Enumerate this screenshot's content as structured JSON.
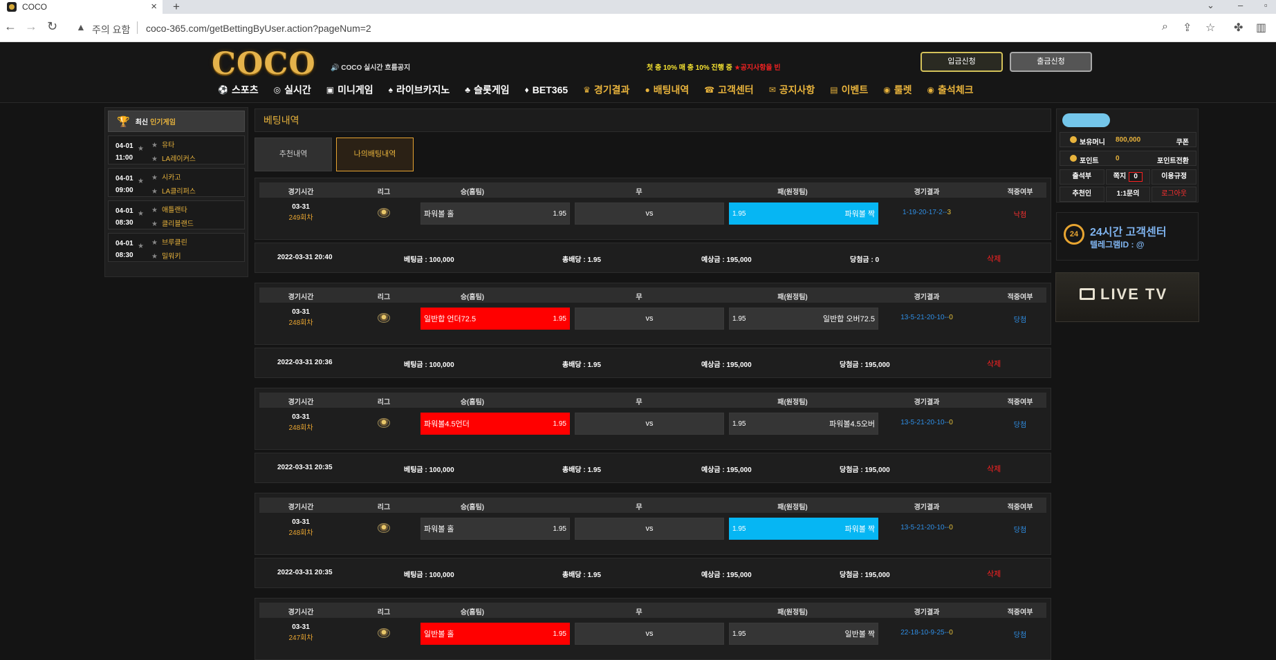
{
  "browser": {
    "tab_title": "COCO",
    "tab_close": "×",
    "new_tab": "+",
    "warning_label": "주의 요함",
    "url": "coco-365.com/getBettingByUser.action?pageNum=2"
  },
  "header": {
    "logo": "COCO",
    "marquee": "🔊 COCO 실시간 흐름공지",
    "event_text": "첫 충 10% 매 충 10% 진행 중 ",
    "event_red": "★공지사항을 빈",
    "deposit_label": "입금신청",
    "withdraw_label": "출금신청"
  },
  "nav": [
    {
      "icon": "⚽",
      "label": "스포츠",
      "gold": false
    },
    {
      "icon": "◎",
      "label": "실시간",
      "gold": false
    },
    {
      "icon": "▣",
      "label": "미니게임",
      "gold": false
    },
    {
      "icon": "♠",
      "label": "라이브카지노",
      "gold": false
    },
    {
      "icon": "♣",
      "label": "슬롯게임",
      "gold": false
    },
    {
      "icon": "♦",
      "label": "BET365",
      "gold": false
    },
    {
      "icon": "♛",
      "label": "경기결과",
      "gold": true
    },
    {
      "icon": "●",
      "label": "배팅내역",
      "gold": true
    },
    {
      "icon": "☎",
      "label": "고객센터",
      "gold": true
    },
    {
      "icon": "✉",
      "label": "공지사항",
      "gold": true
    },
    {
      "icon": "▤",
      "label": "이벤트",
      "gold": true
    },
    {
      "icon": "◉",
      "label": "룰렛",
      "gold": true
    },
    {
      "icon": "◉",
      "label": "출석체크",
      "gold": true
    }
  ],
  "left": {
    "title_a": "최신",
    "title_b": "인기게임",
    "games": [
      {
        "date": "04-01",
        "time": "11:00",
        "home": "유타",
        "away": "LA레이커스"
      },
      {
        "date": "04-01",
        "time": "09:00",
        "home": "시카고",
        "away": "LA클리퍼스"
      },
      {
        "date": "04-01",
        "time": "08:30",
        "home": "애틀랜타",
        "away": "클리블랜드"
      },
      {
        "date": "04-01",
        "time": "08:30",
        "home": "브루클린",
        "away": "밀워키"
      }
    ]
  },
  "content": {
    "section_title": "베팅내역",
    "tab_recommend": "추천내역",
    "tab_my": "나의배팅내역",
    "headers": {
      "time": "경기시간",
      "league": "리그",
      "home": "승(홈팀)",
      "draw": "무",
      "away": "패(원정팀)",
      "result": "경기결과",
      "status": "적중여부"
    },
    "vs": "vs",
    "delete": "삭제",
    "bets": [
      {
        "date": "03-31",
        "round": "249회차",
        "home": "파워볼 홀",
        "home_odd": "1.95",
        "away": "파워볼 짝",
        "away_odd": "1.95",
        "result": "1-19-20-17-2--",
        "result_last": "3",
        "status": "낙첨",
        "bet_time": "2022-03-31 20:40",
        "stake": "베팅금 : 100,000",
        "total_odd": "총배당 : 1.95",
        "expected": "예상금 : 195,000",
        "won": "당첨금 : 0"
      },
      {
        "date": "03-31",
        "round": "248회차",
        "home": "일반합 언더72.5",
        "home_odd": "1.95",
        "away": "일반합 오버72.5",
        "away_odd": "1.95",
        "result": "13-5-21-20-10--",
        "result_last": "0",
        "status": "당첨",
        "bet_time": "2022-03-31 20:36",
        "stake": "베팅금 : 100,000",
        "total_odd": "총배당 : 1.95",
        "expected": "예상금 : 195,000",
        "won": "당첨금 : 195,000"
      },
      {
        "date": "03-31",
        "round": "248회차",
        "home": "파워볼4.5언더",
        "home_odd": "1.95",
        "away": "파워볼4.5오버",
        "away_odd": "1.95",
        "result": "13-5-21-20-10--",
        "result_last": "0",
        "status": "당첨",
        "bet_time": "2022-03-31 20:35",
        "stake": "베팅금 : 100,000",
        "total_odd": "총배당 : 1.95",
        "expected": "예상금 : 195,000",
        "won": "당첨금 : 195,000"
      },
      {
        "date": "03-31",
        "round": "248회차",
        "home": "파워볼 홀",
        "home_odd": "1.95",
        "away": "파워볼 짝",
        "away_odd": "1.95",
        "result": "13-5-21-20-10--",
        "result_last": "0",
        "status": "당첨",
        "bet_time": "2022-03-31 20:35",
        "stake": "베팅금 : 100,000",
        "total_odd": "총배당 : 1.95",
        "expected": "예상금 : 195,000",
        "won": "당첨금 : 195,000"
      },
      {
        "date": "03-31",
        "round": "247회차",
        "home": "일반볼 홀",
        "home_odd": "1.95",
        "away": "일반볼 짝",
        "away_odd": "1.95",
        "result": "22-18-10-9-25--",
        "result_last": "0",
        "status": "당첨"
      }
    ]
  },
  "right": {
    "money_label": "보유머니",
    "money_value": "800,000",
    "coupon": "쿠폰",
    "point_label": "포인트",
    "point_value": "0",
    "point_convert": "포인트전환",
    "attendance": "출석부",
    "memo": "쪽지",
    "memo_count": "0",
    "rules": "이용규정",
    "referrer": "추천인",
    "inquiry": "1:1문의",
    "logout": "로그아웃",
    "support_title": "24시간 고객센터",
    "support_sub": "텔레그램ID : @",
    "badge24": "24",
    "live_tv": "LIVE TV"
  }
}
